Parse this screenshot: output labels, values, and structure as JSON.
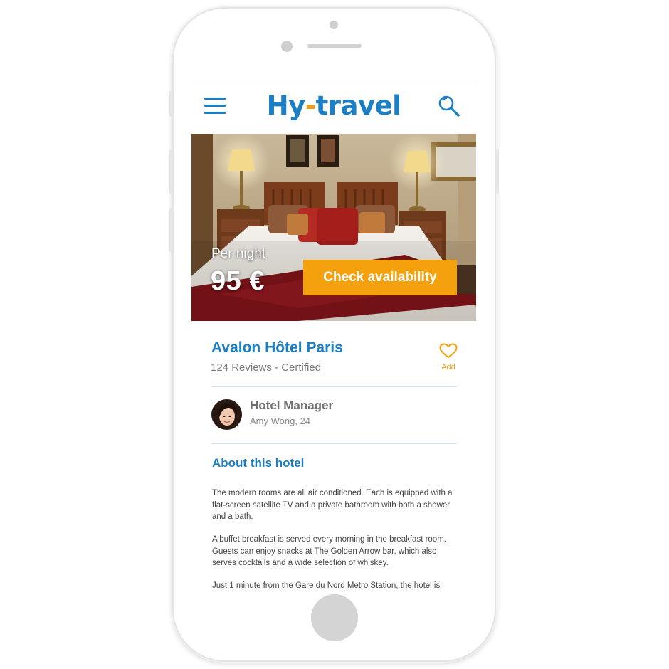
{
  "header": {
    "logo_hy": "Hy",
    "logo_dash": "-",
    "logo_travel": "travel"
  },
  "hero": {
    "per_night_label": "Per night",
    "price": "95 €",
    "check_availability_label": "Check availability"
  },
  "hotel": {
    "name": "Avalon Hôtel Paris",
    "reviews": "124 Reviews - Certified",
    "favorite_label": "Add"
  },
  "manager": {
    "title": "Hotel Manager",
    "name": "Amy Wong, 24"
  },
  "about": {
    "title": "About this hotel",
    "paragraphs": [
      "The modern rooms are all air conditioned. Each is equipped with a flat-screen satellite TV and a private bathroom with both a shower and a bath.",
      "A buffet breakfast is served every morning in the breakfast room. Guests can enjoy snacks at The Golden Arrow bar, which also serves cocktails and a wide selection of whiskey.",
      "Just 1 minute from the Gare du Nord Metro Station, the hotel is"
    ]
  },
  "colors": {
    "brand_blue": "#1a7fc4",
    "accent_orange": "#f5a10e"
  },
  "icons": [
    "hamburger-menu-icon",
    "search-icon",
    "heart-icon",
    "home-button"
  ]
}
